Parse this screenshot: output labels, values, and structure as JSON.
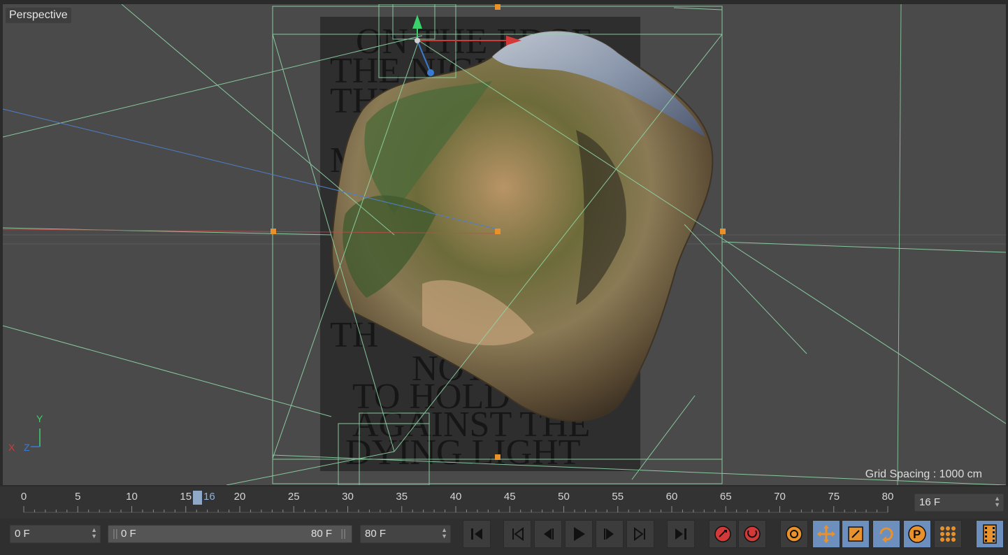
{
  "viewport": {
    "label": "Perspective",
    "grid_spacing": "Grid Spacing : 1000 cm",
    "axes": {
      "x": "X",
      "y": "Y",
      "z": "Z"
    },
    "poster_text_lines": [
      "ON THE EDGE",
      "THE NIGHT",
      "THE",
      "M",
      "TH",
      "NOT",
      "TO HOLD",
      "AGAINST THE",
      "DYING LIGHT"
    ]
  },
  "timeline": {
    "tick_labels": [
      "0",
      "5",
      "10",
      "15",
      "20",
      "25",
      "30",
      "35",
      "40",
      "45",
      "50",
      "55",
      "60",
      "65",
      "70",
      "75",
      "80"
    ],
    "current_frame": "16",
    "frame_field": "16 F"
  },
  "controls": {
    "start_field": "0 F",
    "range_start": "0 F",
    "range_end": "80 F",
    "end_field": "80 F",
    "icons": [
      "go-to-start-icon",
      "go-to-previous-key-icon",
      "step-back-icon",
      "play-icon",
      "step-forward-icon",
      "go-to-next-key-icon",
      "go-to-end-icon",
      "record-icon",
      "autokey-icon",
      "keyframe-settings-icon",
      "move-key-icon",
      "scale-key-icon",
      "rotate-key-icon",
      "param-key-icon",
      "point-level-icon",
      "timeline-window-icon"
    ]
  },
  "colors": {
    "accent_orange": "#e9912a",
    "selection_blue": "#6d8fbd",
    "wire_green": "#8fd6a8",
    "record_red": "#d23a3a"
  }
}
